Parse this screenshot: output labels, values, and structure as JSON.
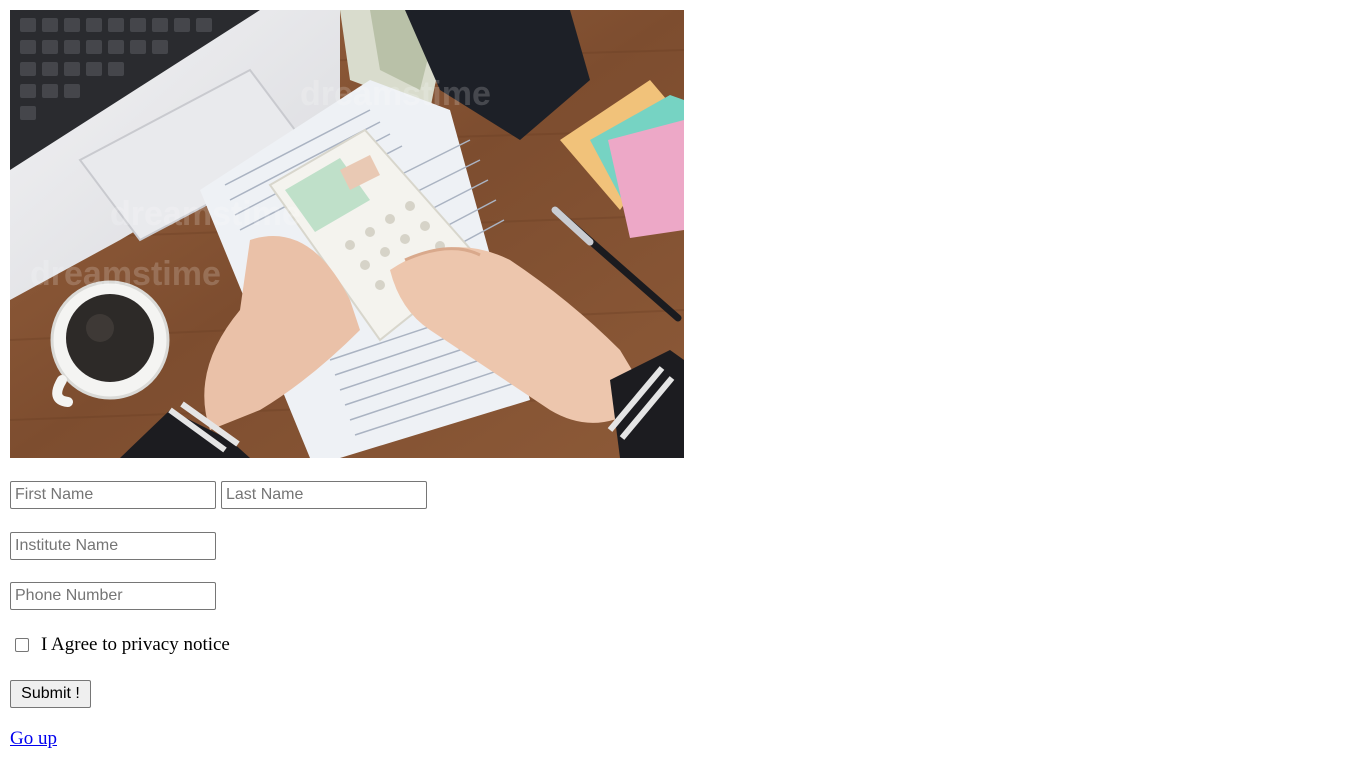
{
  "hero_image": {
    "description_icon": "photo-desk-calculator"
  },
  "form": {
    "first_name_placeholder": "First Name",
    "last_name_placeholder": "Last Name",
    "institute_placeholder": "Institute Name",
    "phone_placeholder": "Phone Number",
    "first_name_value": "",
    "last_name_value": "",
    "institute_value": "",
    "phone_value": "",
    "agree_label": "I Agree to privacy notice",
    "agree_checked": false,
    "submit_label": "Submit !"
  },
  "footer": {
    "go_up_label": "Go up"
  },
  "colors": {
    "link": "#0000ee",
    "input_border": "#767676",
    "button_bg": "#efefef"
  }
}
